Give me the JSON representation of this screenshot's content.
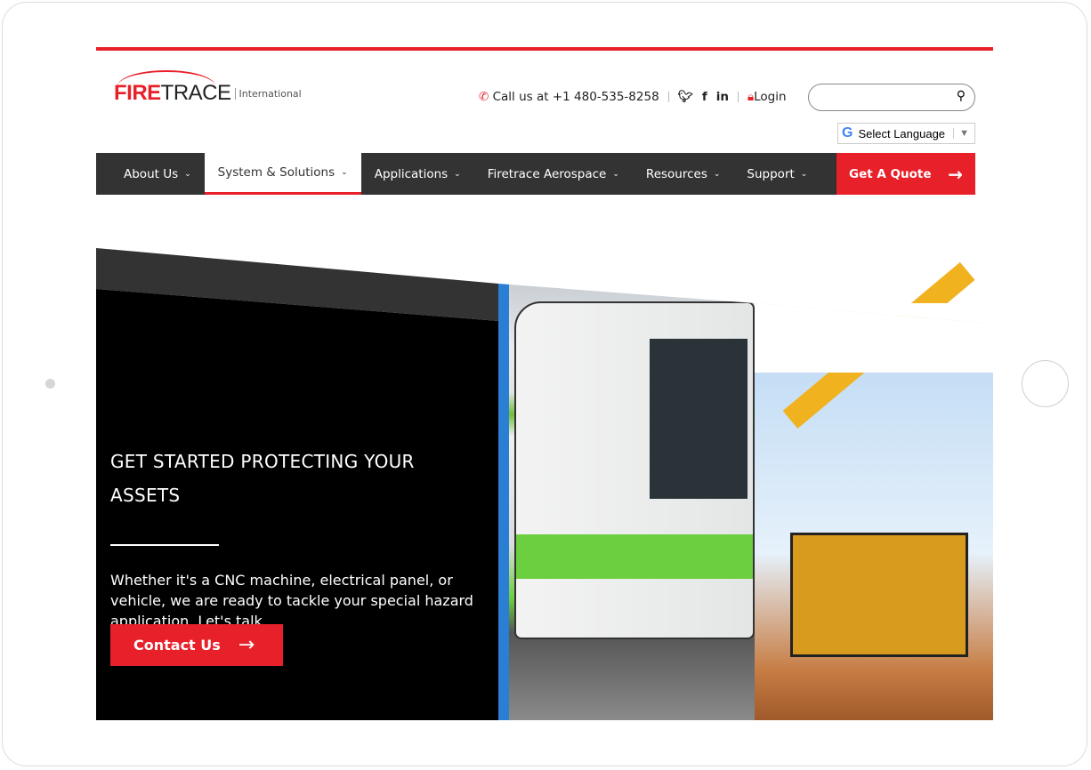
{
  "brand": {
    "fire": "FIRE",
    "trace": "TRACE",
    "intl": "International"
  },
  "utility": {
    "phone": "Call us at +1 480-535-8258",
    "twitter": "twitter-icon",
    "facebook": "f",
    "linkedin": "in",
    "login": "Login"
  },
  "search": {
    "placeholder": ""
  },
  "language": {
    "label": "Select Language",
    "g": "G",
    "arrow": "▼"
  },
  "nav": {
    "items": [
      "About Us",
      "System & Solutions",
      "Applications",
      "Firetrace Aerospace",
      "Resources",
      "Support"
    ],
    "active": "System & Solutions",
    "quote": "Get A Quote"
  },
  "hero": {
    "title": "GET STARTED PROTECTING YOUR ASSETS",
    "body": "Whether it's a CNC machine, electrical panel, or vehicle, we are ready to tackle your special hazard application. Let's talk.",
    "cta": "Contact Us"
  },
  "colors": {
    "accent": "#e8202a",
    "nav_bg": "#333333"
  }
}
